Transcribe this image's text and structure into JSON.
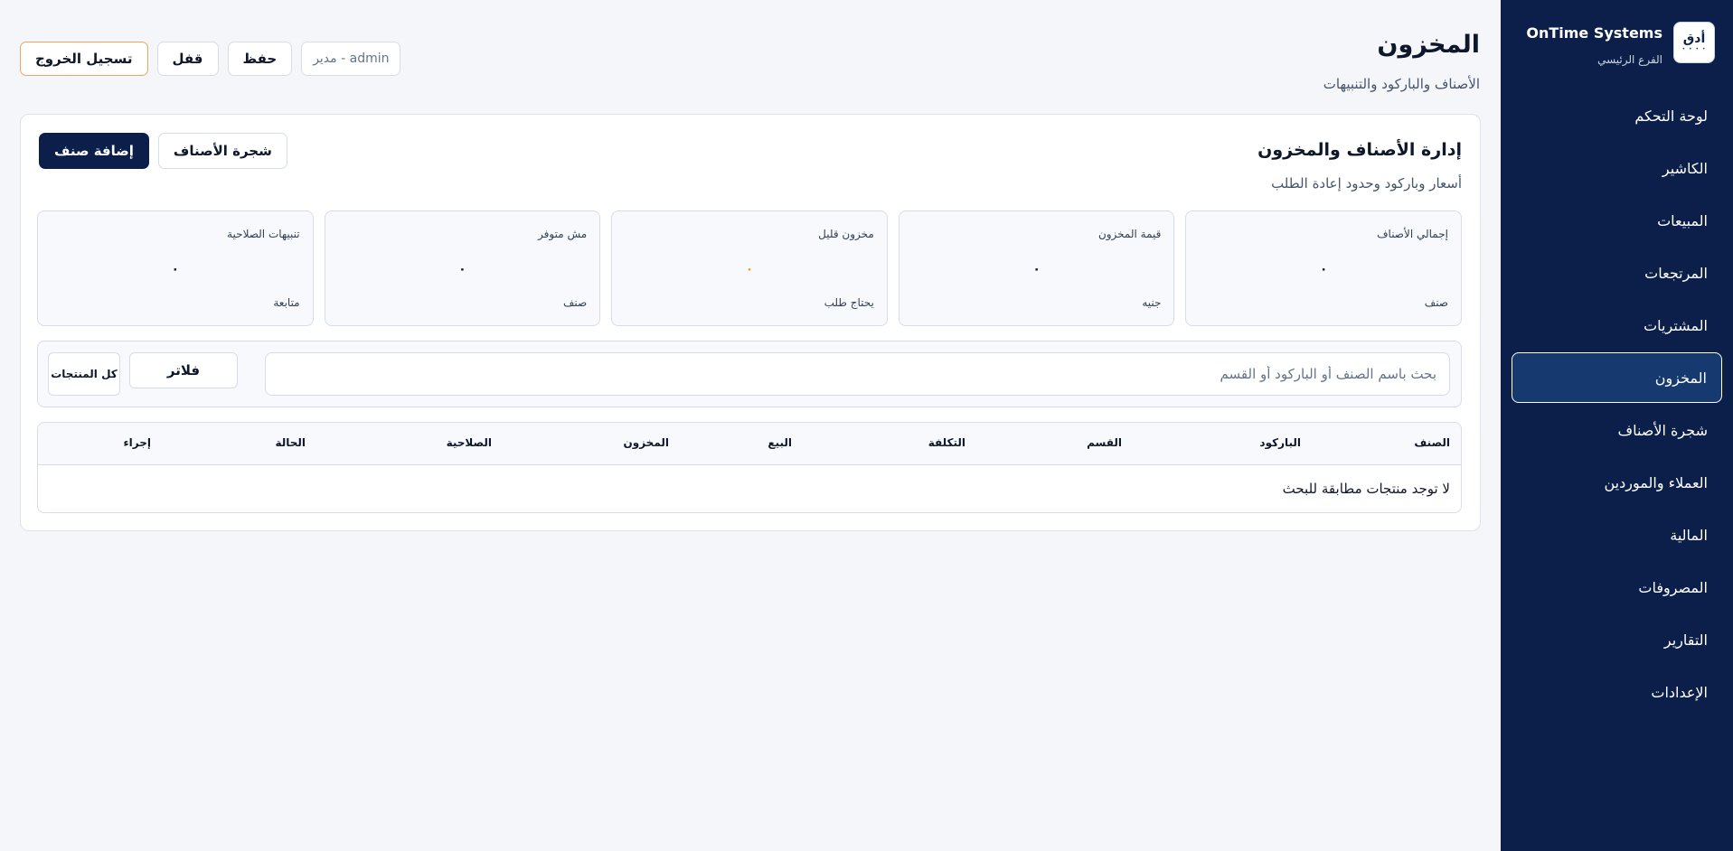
{
  "brand": {
    "name": "OnTime Systems",
    "branch": "الفرع الرئيسي",
    "logo_text": "أدق",
    "logo_sub": "• • • •"
  },
  "sidebar": {
    "items": [
      {
        "label": "لوحة التحكم",
        "active": false
      },
      {
        "label": "الكاشير",
        "active": false
      },
      {
        "label": "المبيعات",
        "active": false
      },
      {
        "label": "المرتجعات",
        "active": false
      },
      {
        "label": "المشتريات",
        "active": false
      },
      {
        "label": "المخزون",
        "active": true
      },
      {
        "label": "شجرة الأصناف",
        "active": false
      },
      {
        "label": "العملاء والموردين",
        "active": false
      },
      {
        "label": "المالية",
        "active": false
      },
      {
        "label": "المصروفات",
        "active": false
      },
      {
        "label": "التقارير",
        "active": false
      },
      {
        "label": "الإعدادات",
        "active": false
      }
    ]
  },
  "header": {
    "title": "المخزون",
    "subtitle": "الأصناف والباركود والتنبيهات",
    "user": "admin - مدير",
    "save_label": "حفظ",
    "lock_label": "قفل",
    "logout_label": "تسجيل الخروج"
  },
  "panel": {
    "title": "إدارة الأصناف والمخزون",
    "subtitle": "أسعار وباركود وحدود إعادة الطلب",
    "add_label": "إضافة صنف",
    "tree_label": "شجرة الأصناف"
  },
  "stats": [
    {
      "label": "إجمالي الأصناف",
      "value": "٠",
      "unit": "صنف"
    },
    {
      "label": "قيمة المخزون",
      "value": "٠",
      "unit": "جنيه"
    },
    {
      "label": "مخزون قليل",
      "value": "٠",
      "unit": "يحتاج طلب"
    },
    {
      "label": "مش متوفر",
      "value": "٠",
      "unit": "صنف"
    },
    {
      "label": "تنبيهات الصلاحية",
      "value": "٠",
      "unit": "متابعة"
    }
  ],
  "filters": {
    "search_placeholder": "بحث باسم الصنف أو الباركود أو القسم",
    "filter_label": "فلاتر",
    "category_selected": "كل المنتجات"
  },
  "table": {
    "columns": [
      "الصنف",
      "الباركود",
      "القسم",
      "التكلفة",
      "البيع",
      "المخزون",
      "الصلاحية",
      "الحالة",
      "إجراء"
    ],
    "empty_message": "لا توجد منتجات مطابقة للبحث"
  },
  "colors": {
    "sidebar_bg": "#0b1f4a",
    "sidebar_active": "#163a70",
    "primary": "#0b1f4a",
    "warn": "#f59e0b",
    "logout_border": "#f4a261"
  }
}
